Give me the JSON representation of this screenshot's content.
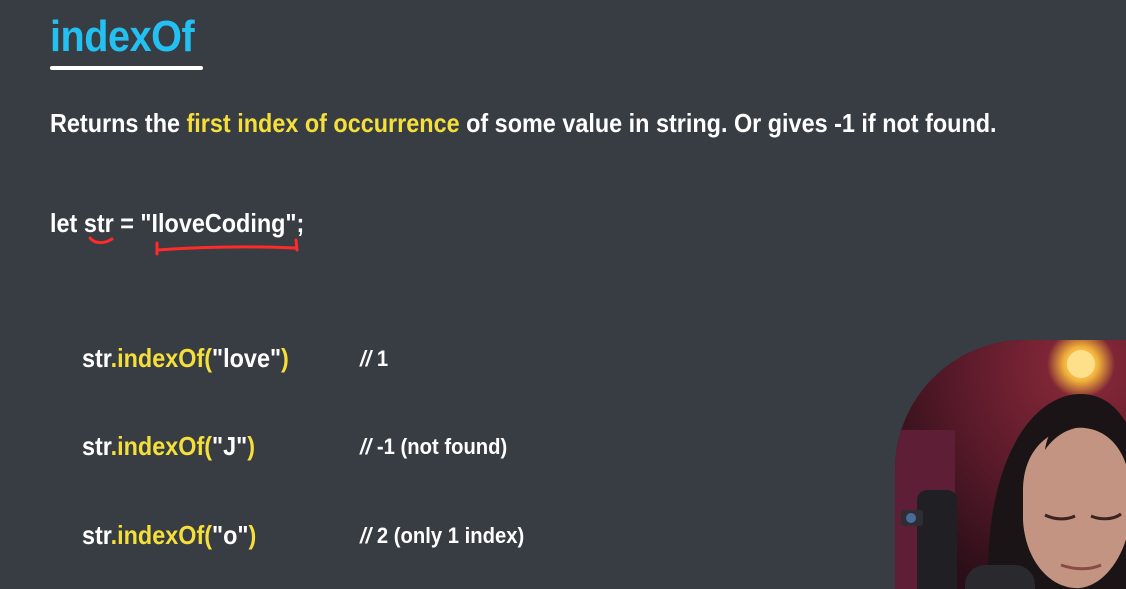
{
  "slide": {
    "title": "indexOf",
    "description": {
      "before": "Returns the ",
      "highlight": "first index of occurrence",
      "after": " of some value in string. Or gives -1 if not found."
    },
    "declaration": {
      "keyword": "let",
      "variable": "str",
      "equals": "=",
      "value": "\"IloveCoding\"",
      "terminator": ";"
    },
    "examples": [
      {
        "object": "str",
        "method": ".indexOf(",
        "arg": "\"love\"",
        "close": ")",
        "comment_slashes": "//",
        "comment_text": "1"
      },
      {
        "object": "str",
        "method": ".indexOf(",
        "arg": "\"J\"",
        "close": ")",
        "comment_slashes": "//",
        "comment_text": "-1 (not found)"
      },
      {
        "object": "str",
        "method": ".indexOf(",
        "arg": "\"o\"",
        "close": ")",
        "comment_slashes": "//",
        "comment_text": "2 (only 1 index)"
      }
    ]
  },
  "colors": {
    "background": "#383c43",
    "title": "#23c1f2",
    "highlight": "#f5df3a",
    "text": "#ffffff",
    "annotation": "#ff2a2a"
  }
}
